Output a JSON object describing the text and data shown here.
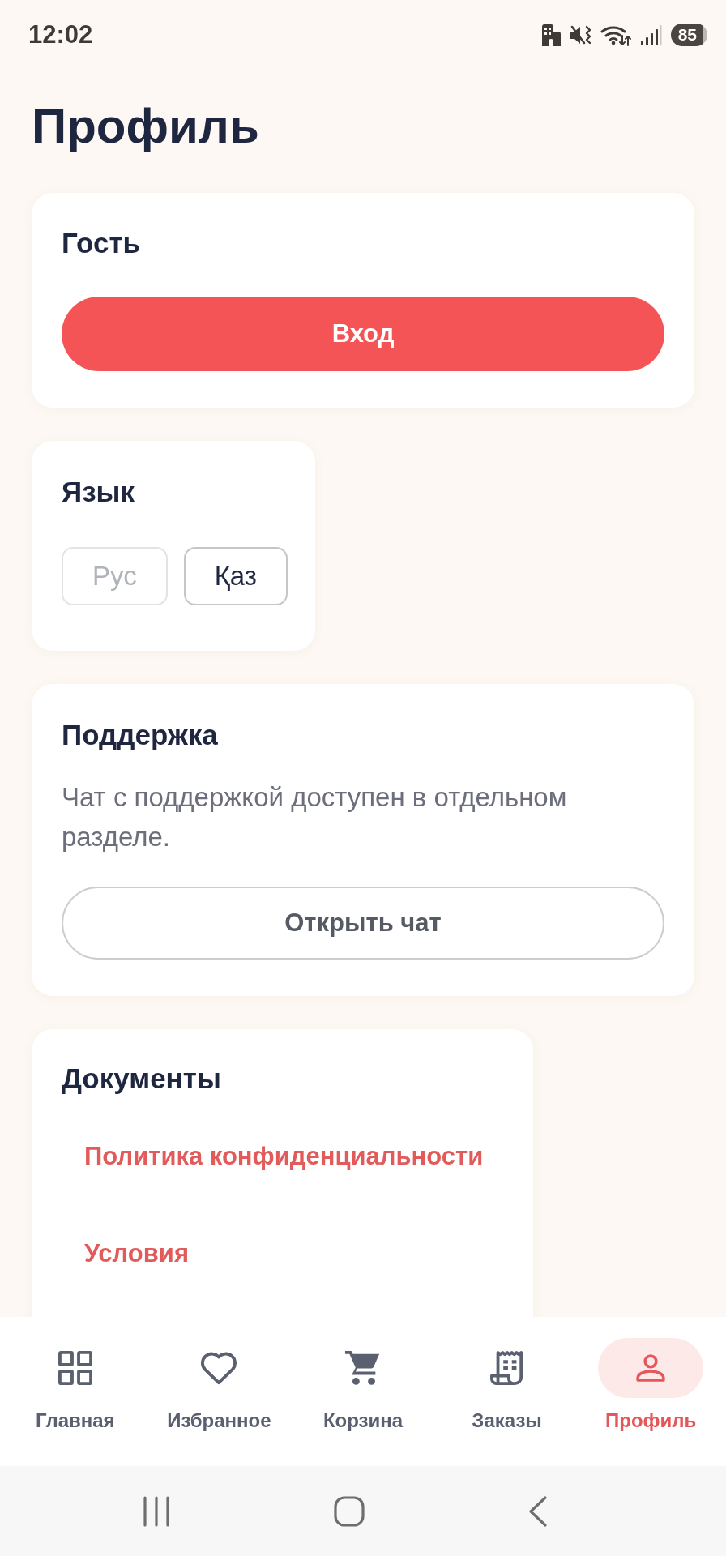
{
  "status_bar": {
    "time": "12:02",
    "battery": "85"
  },
  "header": {
    "title": "Профиль"
  },
  "guest_card": {
    "title": "Гость",
    "button": "Вход"
  },
  "language_card": {
    "title": "Язык",
    "options": [
      {
        "label": "Рус",
        "disabled": true
      },
      {
        "label": "Қаз",
        "disabled": false
      }
    ]
  },
  "support_card": {
    "title": "Поддержка",
    "text": "Чат с поддержкой доступен в отдельном разделе.",
    "button": "Открыть чат"
  },
  "documents_card": {
    "title": "Документы",
    "links": [
      "Политика конфиденциальности",
      "Условия"
    ]
  },
  "bottom_nav": [
    {
      "label": "Главная",
      "selected": false
    },
    {
      "label": "Избранное",
      "selected": false
    },
    {
      "label": "Корзина",
      "selected": false
    },
    {
      "label": "Заказы",
      "selected": false
    },
    {
      "label": "Профиль",
      "selected": true
    }
  ]
}
